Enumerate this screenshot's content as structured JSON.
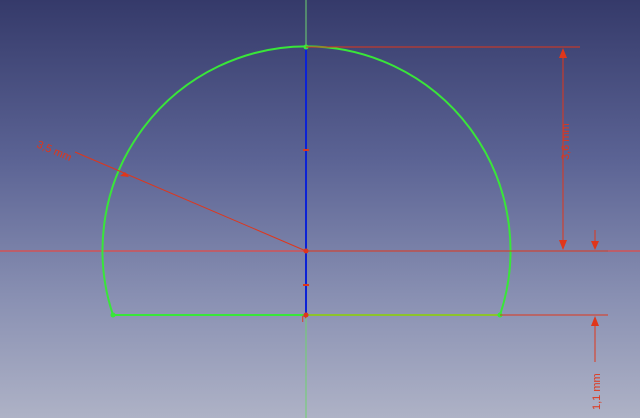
{
  "colors": {
    "background_top": "#353a6a",
    "background_bottom": "#aeb2c6",
    "axis_horizontal": "#ff3b2b",
    "axis_vertical": "#6ed36e",
    "geometry": "#39e639",
    "construction_line": "#0b22d6",
    "dimension": "#e0361a"
  },
  "dimensions": {
    "radius_label": "3,5 mm",
    "height_label": "3,6 mm",
    "offset_label": "1,1 mm"
  }
}
